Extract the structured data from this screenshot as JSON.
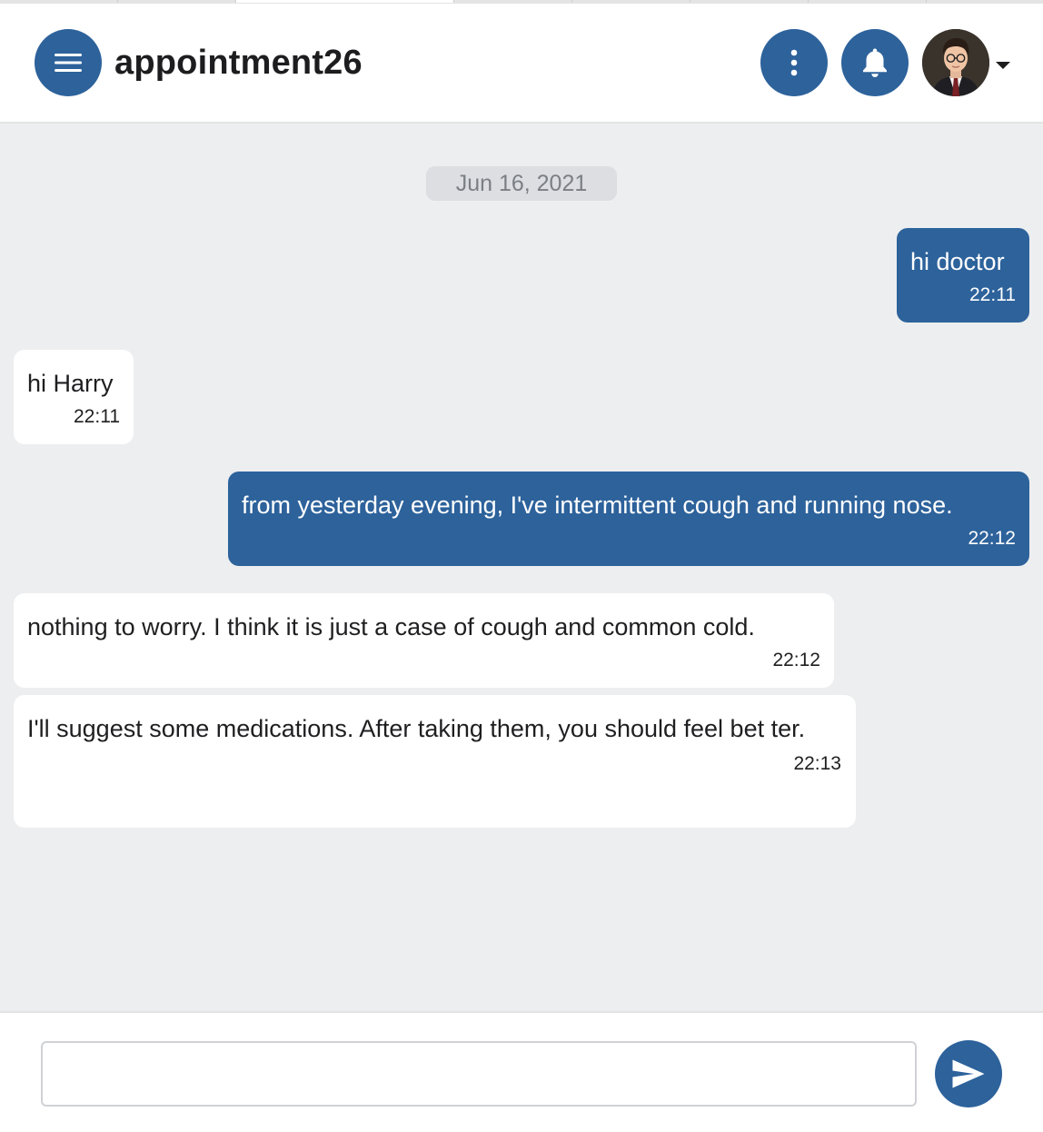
{
  "header": {
    "title": "appointment26",
    "menu_icon": "hamburger-menu-icon",
    "more_icon": "more-vertical-icon",
    "bell_icon": "bell-icon",
    "avatar_icon": "user-avatar"
  },
  "chat": {
    "date_separator": "Jun 16, 2021",
    "messages": [
      {
        "direction": "sent",
        "text": "hi doctor",
        "time": "22:11"
      },
      {
        "direction": "received",
        "text": "hi Harry",
        "time": "22:11"
      },
      {
        "direction": "sent",
        "text": "from yesterday evening, I've intermittent cough and running nose.",
        "time": "22:12"
      },
      {
        "direction": "received",
        "text": "nothing to worry. I think it is just a case of cough and common cold.",
        "time": "22:12"
      },
      {
        "direction": "received",
        "text": "I'll suggest some medications. After taking them, you should feel bet ter.",
        "time": "22:13"
      }
    ]
  },
  "composer": {
    "input_value": "",
    "input_placeholder": "",
    "send_icon": "send-icon"
  },
  "colors": {
    "primary": "#2d629b",
    "background": "#edeef0",
    "received_bubble": "#ffffff"
  }
}
